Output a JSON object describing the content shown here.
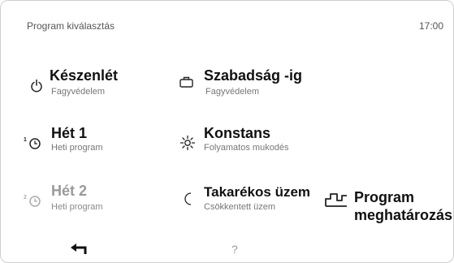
{
  "header": {
    "title": "Program kiválasztás",
    "time": "17:00"
  },
  "programs": [
    {
      "title": "Készenlét",
      "subtitle": "Fagyvédelem",
      "icon": "power-icon",
      "enabled": true
    },
    {
      "title": "Szabadság -ig",
      "subtitle": "Fagyvédelem",
      "icon": "suitcase-icon",
      "enabled": true
    },
    {
      "title": "Hét 1",
      "subtitle": "Heti program",
      "icon": "clock-1-icon",
      "enabled": true
    },
    {
      "title": "Konstans",
      "subtitle": "Folyamatos mukodés",
      "icon": "sun-icon",
      "enabled": true
    },
    {
      "title": "Hét 2",
      "subtitle": "Heti program",
      "icon": "clock-2-icon",
      "enabled": false
    },
    {
      "title": "Takarékos üzem",
      "subtitle": "Csökkentett üzem",
      "icon": "moon-icon",
      "enabled": true
    },
    {
      "title_line1": "Program",
      "title_line2": "meghatározás",
      "icon": "program-curve-icon",
      "enabled": true
    }
  ],
  "footer": {
    "back_icon": "back-arrow-icon",
    "help_label": "?"
  }
}
